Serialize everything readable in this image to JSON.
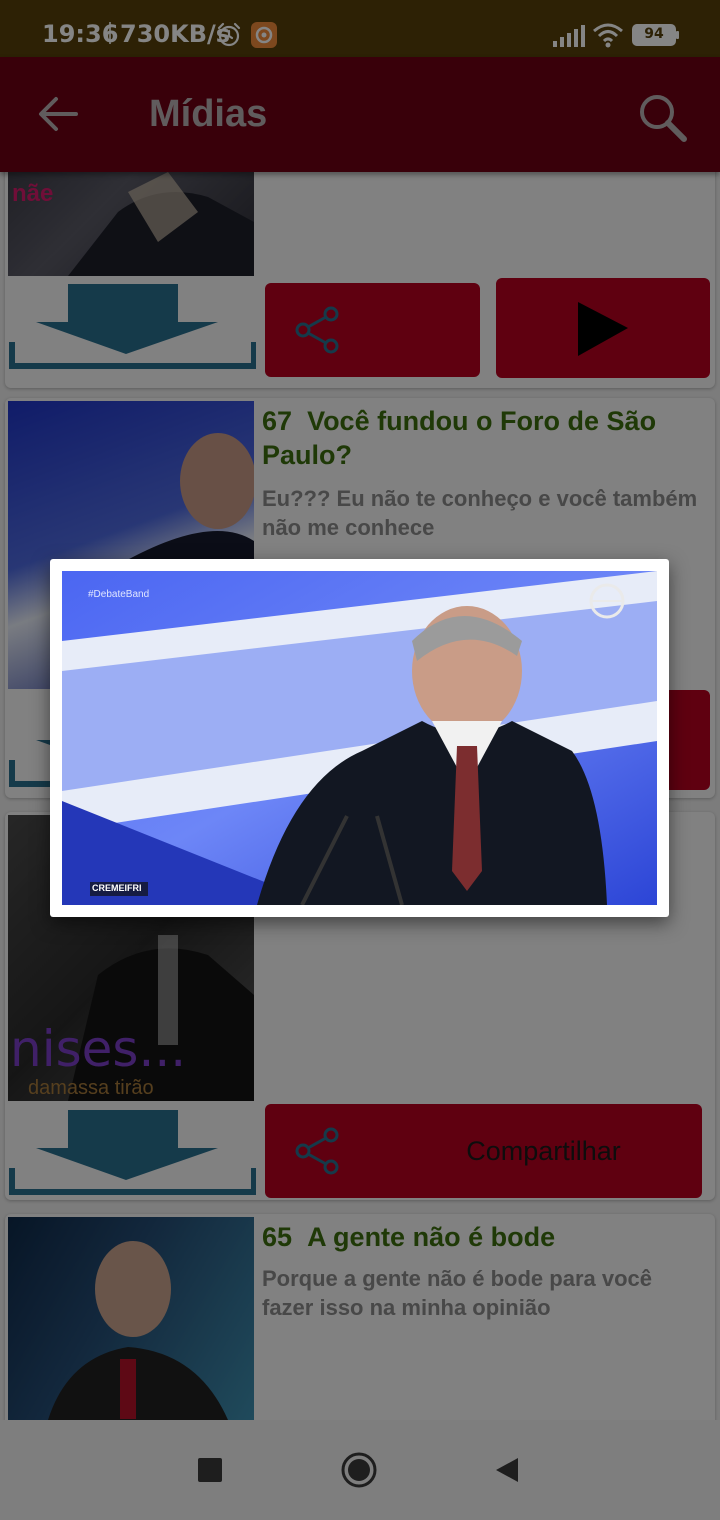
{
  "status_bar": {
    "time": "19:36",
    "speed": "730KB/s",
    "battery": "94",
    "icons": [
      "alarm-icon",
      "app-notification-icon",
      "signal-icon",
      "wifi-icon",
      "battery-icon"
    ]
  },
  "app_bar": {
    "title": "Mídias",
    "back_icon": "arrow-left-icon",
    "search_icon": "search-icon"
  },
  "items": [
    {
      "number": "",
      "title": "",
      "description": "",
      "thumb_text": "nãe",
      "actions": [
        "download",
        "share",
        "play"
      ]
    },
    {
      "number": "67",
      "title": "Você fundou o Foro de São Paulo?",
      "description": "Eu??? Eu não te conheço e você também não me conhece",
      "actions": [
        "download",
        "share",
        "play"
      ]
    },
    {
      "number": "",
      "title": "",
      "description": "",
      "thumb_text": "nises...",
      "thumb_subtext": "damassa   tirão",
      "share_label": "Compartilhar",
      "actions": [
        "download",
        "share"
      ]
    },
    {
      "number": "65",
      "title": "A gente não é bode",
      "description": "Porque a gente não é bode para você fazer isso na minha opinião",
      "actions": []
    }
  ],
  "dialog": {
    "media_overlay_text": "#DebateBand",
    "media_badge": "CREMEIFRI"
  },
  "nav_bar": {
    "icons": [
      "recent-apps-icon",
      "home-icon",
      "back-icon"
    ]
  },
  "colors": {
    "status_bar": "#56400a",
    "app_bar": "#6d0015",
    "accent_button": "#b7001f",
    "title_green": "#3c6e0f",
    "download_blue": "#2a6f8f"
  }
}
